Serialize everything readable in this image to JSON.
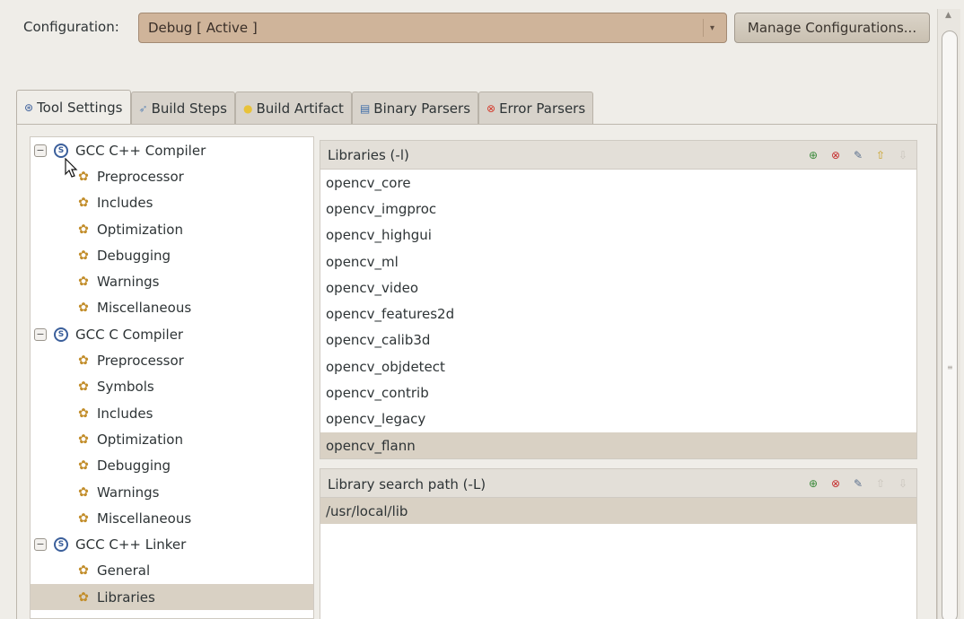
{
  "configuration": {
    "label": "Configuration:",
    "value": "Debug  [ Active ]",
    "arrow_icon": "▾",
    "manage_button": "Manage Configurations..."
  },
  "tabs": [
    {
      "label": "Tool Settings",
      "icon": "tool-settings-icon",
      "active": true
    },
    {
      "label": "Build Steps",
      "icon": "build-steps-icon",
      "active": false
    },
    {
      "label": "Build Artifact",
      "icon": "build-artifact-icon",
      "active": false
    },
    {
      "label": "Binary Parsers",
      "icon": "binary-parsers-icon",
      "active": false
    },
    {
      "label": "Error Parsers",
      "icon": "error-parsers-icon",
      "active": false
    }
  ],
  "tree": {
    "items": [
      {
        "label": "GCC C++ Compiler",
        "level": 0,
        "expander": "−"
      },
      {
        "label": "Preprocessor",
        "level": 1
      },
      {
        "label": "Includes",
        "level": 1
      },
      {
        "label": "Optimization",
        "level": 1
      },
      {
        "label": "Debugging",
        "level": 1
      },
      {
        "label": "Warnings",
        "level": 1
      },
      {
        "label": "Miscellaneous",
        "level": 1
      },
      {
        "label": "GCC C Compiler",
        "level": 0,
        "expander": "−"
      },
      {
        "label": "Preprocessor",
        "level": 1
      },
      {
        "label": "Symbols",
        "level": 1
      },
      {
        "label": "Includes",
        "level": 1
      },
      {
        "label": "Optimization",
        "level": 1
      },
      {
        "label": "Debugging",
        "level": 1
      },
      {
        "label": "Warnings",
        "level": 1
      },
      {
        "label": "Miscellaneous",
        "level": 1
      },
      {
        "label": "GCC C++ Linker",
        "level": 0,
        "expander": "−"
      },
      {
        "label": "General",
        "level": 1
      },
      {
        "label": "Libraries",
        "level": 1,
        "selected": true
      }
    ]
  },
  "libraries": {
    "title": "Libraries (-l)",
    "items": [
      "opencv_core",
      "opencv_imgproc",
      "opencv_highgui",
      "opencv_ml",
      "opencv_video",
      "opencv_features2d",
      "opencv_calib3d",
      "opencv_objdetect",
      "opencv_contrib",
      "opencv_legacy",
      "opencv_flann"
    ],
    "selected_index": 10
  },
  "library_paths": {
    "title": "Library search path (-L)",
    "items": [
      "/usr/local/lib"
    ],
    "selected_index": 0
  },
  "header_tools": [
    "add-icon",
    "delete-icon",
    "edit-icon",
    "move-up-icon",
    "move-down-icon"
  ],
  "colors": {
    "combo_bg": "#cfb49a",
    "selection": "#d9d1c4",
    "window_bg": "#efede8"
  }
}
